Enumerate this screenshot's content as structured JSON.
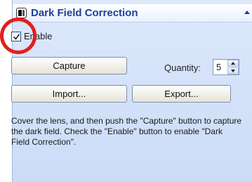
{
  "panel": {
    "title": "Dark Field Correction",
    "header_icon": "camera-module-icon",
    "collapse_icon": "chevron-up-icon"
  },
  "enable": {
    "label": "Enable",
    "checked": true
  },
  "buttons": {
    "capture": "Capture",
    "import": "Import...",
    "export": "Export..."
  },
  "quantity": {
    "label": "Quantity:",
    "value": "5"
  },
  "description": "Cover the lens, and then push the \"Capture\" button to capture the dark field. Check the \"Enable\" button to enable \"Dark Field Correction\".",
  "colors": {
    "title": "#1e3f99",
    "highlight_circle": "#e41e1e",
    "panel_background": "#dde8fb"
  }
}
